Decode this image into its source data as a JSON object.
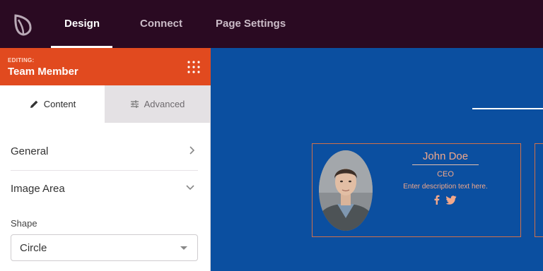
{
  "topnav": {
    "tabs": [
      {
        "label": "Design",
        "active": true
      },
      {
        "label": "Connect",
        "active": false
      },
      {
        "label": "Page Settings",
        "active": false
      }
    ]
  },
  "sidebar": {
    "editing_label": "EDITING:",
    "editing_title": "Team Member",
    "subtabs": {
      "content": "Content",
      "advanced": "Advanced"
    },
    "sections": [
      {
        "label": "General",
        "expanded": false
      },
      {
        "label": "Image Area",
        "expanded": true
      }
    ],
    "shape_field": {
      "label": "Shape",
      "value": "Circle"
    }
  },
  "preview": {
    "name": "John Doe",
    "role": "CEO",
    "description": "Enter description text here.",
    "social_icons": [
      "facebook-icon",
      "twitter-icon"
    ]
  },
  "colors": {
    "topbar": "#2a0a22",
    "accent": "#e14a1f",
    "canvas": "#0b4fa0",
    "preview_text": "#f2a88a"
  }
}
